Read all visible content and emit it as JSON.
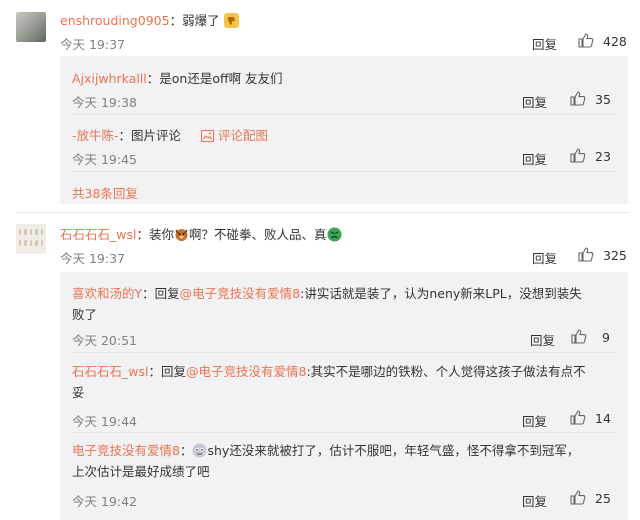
{
  "comments": [
    {
      "username": "enshrouding0905",
      "colon": "：",
      "text": "弱爆了",
      "emoji": "thumbs-down-emoji",
      "time": "今天 19:37",
      "reply_label": "回复",
      "likes": "428"
    },
    {
      "username": "石石石石_wsl",
      "colon": "：",
      "text_before": "装你",
      "emoji_mid": "dog-emoji",
      "text_after": "啊？不碰拳、败人品、真",
      "emoji_end": "angry-face-emoji",
      "time": "今天 19:37",
      "reply_label": "回复",
      "likes": "325"
    }
  ],
  "replies_group1": [
    {
      "username": "Ajxijwhrkalll",
      "text": "：是on还是off啊 友友们",
      "time": "今天 19:38",
      "reply_label": "回复",
      "likes": "35"
    },
    {
      "username": "-放牛陈-",
      "text": "：图片评论",
      "image_link": "评论配图",
      "time": "今天 19:45",
      "reply_label": "回复",
      "likes": "23"
    }
  ],
  "more_replies": "共38条回复",
  "replies_group2": [
    {
      "username": "喜欢和汤的Y",
      "prefix": "：回复",
      "mention": "@电子竞技没有爱情8",
      "line1": ":讲实话就是装了，认为neny新来LPL，没想到装失",
      "line2": "败了",
      "time": "今天 20:51",
      "reply_label": "回复",
      "likes": "9"
    },
    {
      "username": "石石石石_wsl",
      "prefix": "：回复",
      "mention": "@电子竞技没有爱情8",
      "line1": ":其实不是哪边的铁粉、个人觉得这孩子做法有点不",
      "line2": "妥",
      "time": "今天 19:44",
      "reply_label": "回复",
      "likes": "14"
    },
    {
      "username": "电子竞技没有爱情8",
      "colon": "：",
      "emoji": "face-emoji",
      "line1": "shy还没来就被打了，估计不服吧，年轻气盛，怪不得拿不到冠军，",
      "line2": "上次估计是最好成绩了吧",
      "time": "今天 19:42",
      "reply_label": "回复",
      "likes": "25"
    }
  ],
  "icons": {
    "like": "thumbs-up-icon",
    "image": "image-icon",
    "avatar_1": "avatar-enshrouding0905",
    "avatar_2": "avatar-shishi"
  },
  "colors": {
    "username": "#eb7350",
    "time": "#808080",
    "subpanel": "#f2f2f5",
    "divider": "#e6e6e6"
  }
}
